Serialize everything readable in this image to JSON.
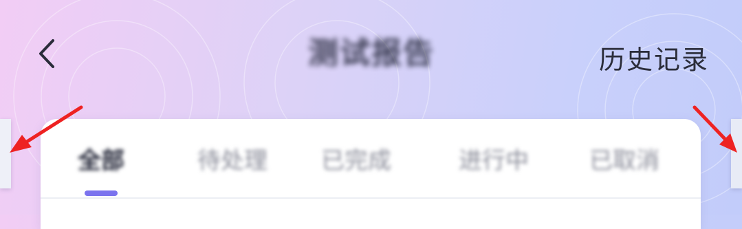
{
  "header": {
    "title": "测试报告",
    "history_label": "历史记录"
  },
  "tabs": [
    {
      "label": "全部",
      "active": true
    },
    {
      "label": "待处理",
      "active": false
    },
    {
      "label": "已完成",
      "active": false
    },
    {
      "label": "进行中",
      "active": false
    },
    {
      "label": "已取消",
      "active": false
    }
  ],
  "colors": {
    "accent": "#7b73ee",
    "annotation_arrow": "#ee2222"
  },
  "icons": {
    "back": "chevron-left-icon",
    "annotation_left": "red-arrow-icon",
    "annotation_right": "red-arrow-icon"
  }
}
